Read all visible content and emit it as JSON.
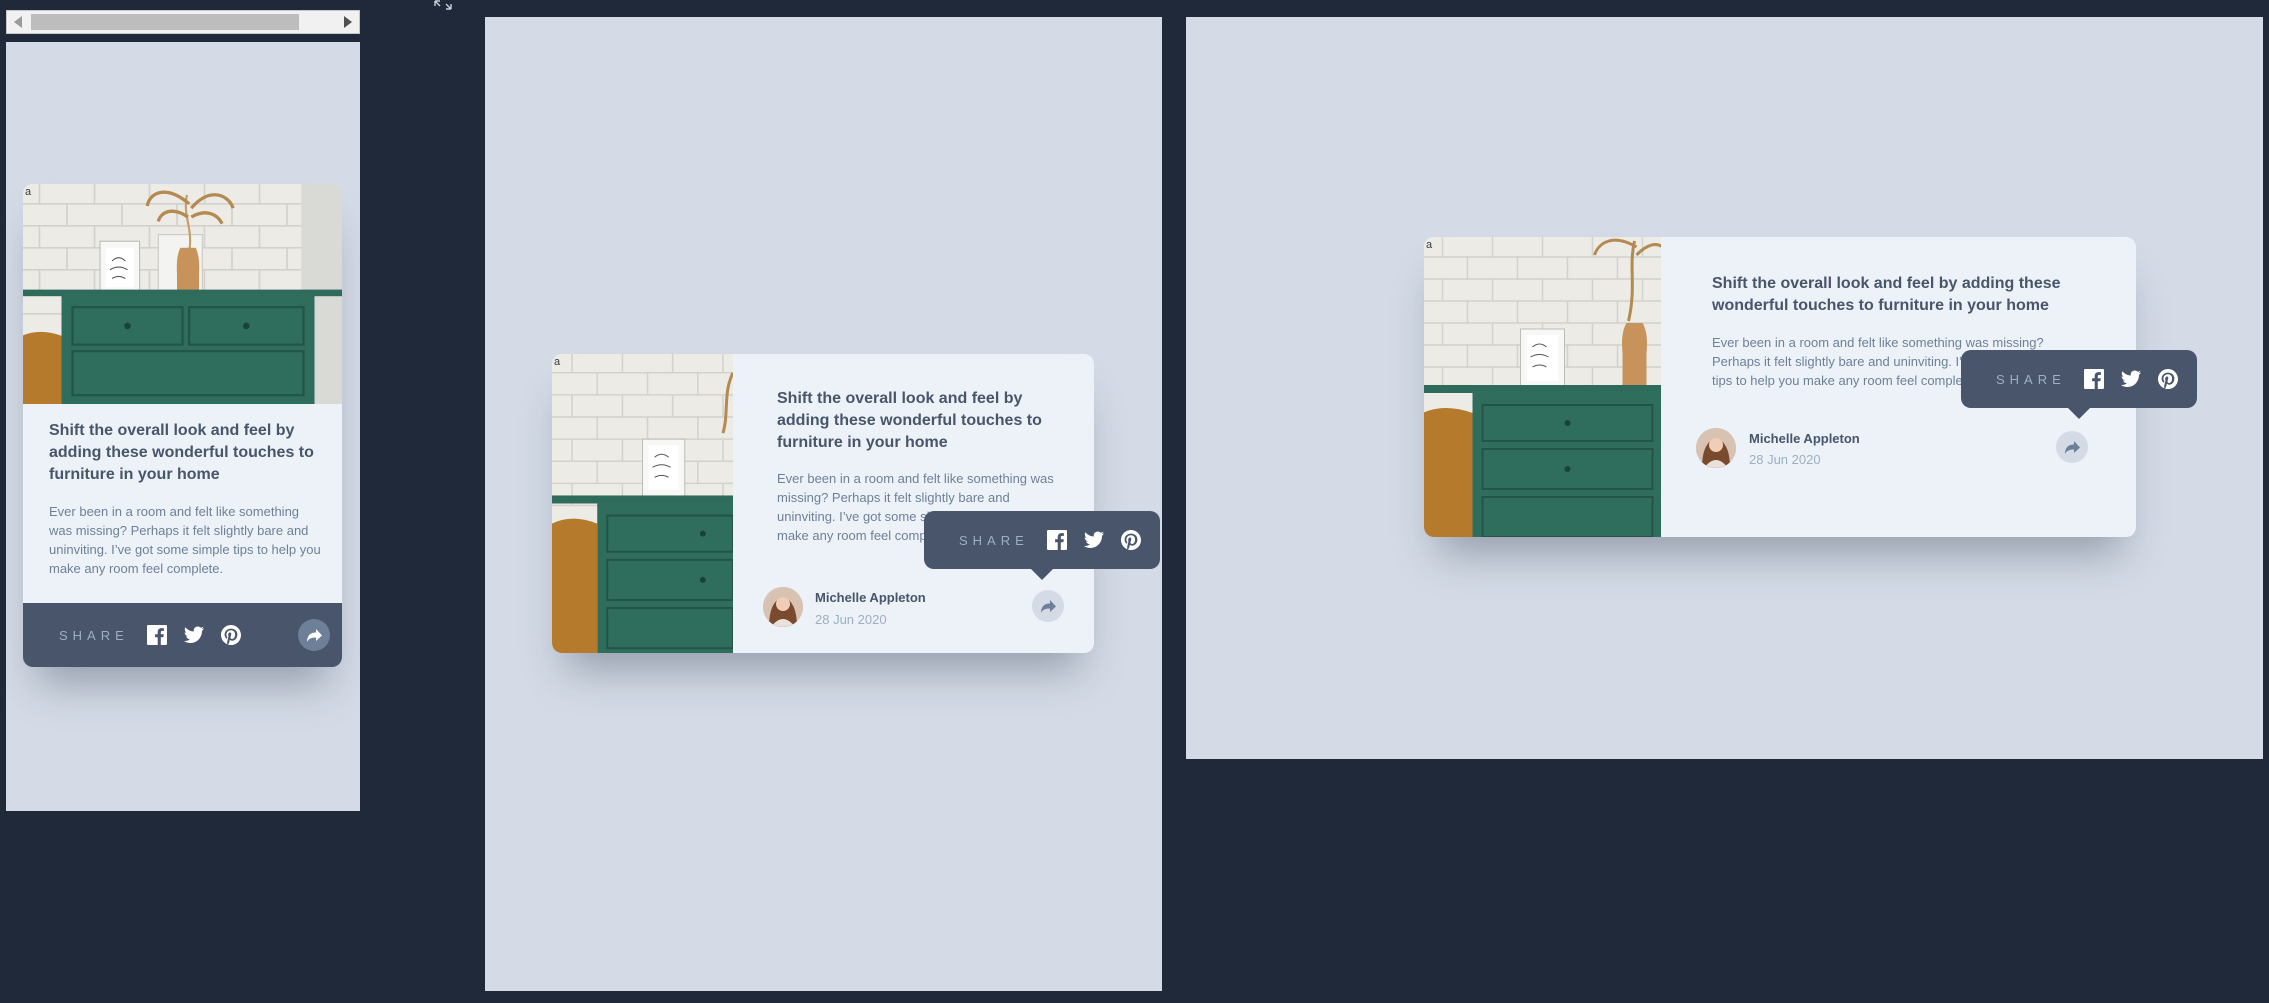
{
  "article": {
    "image_alt": "a",
    "title": "Shift the overall look and feel by adding these wonderful touches to furniture in your home",
    "excerpt": "Ever been in a room and felt like something was missing? Perhaps it felt slightly bare and uninviting. I’ve got some simple tips to help you make any room feel complete.",
    "author_name": "Michelle Appleton",
    "date": "28 Jun 2020"
  },
  "share": {
    "label": "SHARE",
    "icons": [
      "facebook-icon",
      "twitter-icon",
      "pinterest-icon"
    ],
    "toggle_icon": "share-arrow-icon"
  },
  "views": [
    "mobile",
    "tablet",
    "desktop"
  ],
  "colors": {
    "page": "#202939",
    "frame": "#d4dbe7",
    "card": "#ecf2f8",
    "title": "#48556a",
    "text": "#6e8098",
    "muted": "#9eafc2",
    "tooltip": "#48556a"
  }
}
